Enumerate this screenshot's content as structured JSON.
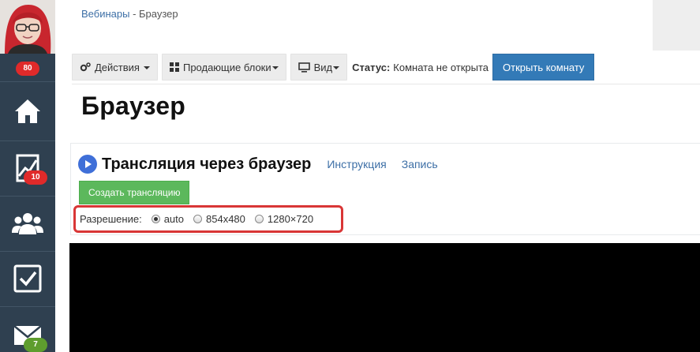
{
  "sidebar": {
    "avatar_badge": "80",
    "items": [
      {
        "icon": "home-icon"
      },
      {
        "icon": "chart-icon",
        "badge": "10"
      },
      {
        "icon": "users-icon"
      },
      {
        "icon": "checkbox-icon"
      },
      {
        "icon": "mail-icon",
        "badge": "7"
      }
    ]
  },
  "breadcrumb": {
    "parent": "Вебинары",
    "separator": " - ",
    "current": "Браузер"
  },
  "toolbar": {
    "actions_label": "Действия",
    "blocks_label": "Продающие блоки",
    "view_label": "Вид",
    "status_label": "Статус:",
    "status_value": "Комната не открыта",
    "open_room_label": "Открыть комнату"
  },
  "page": {
    "title": "Браузер"
  },
  "panel": {
    "title": "Трансляция через браузер",
    "link_instruction": "Инструкция",
    "link_record": "Запись",
    "create_button": "Создать трансляцию",
    "resolution_label": "Разрешение:",
    "resolutions": [
      {
        "label": "auto",
        "checked": true
      },
      {
        "label": "854x480",
        "checked": false
      },
      {
        "label": "1280×720",
        "checked": false
      }
    ]
  },
  "colors": {
    "sidebar_bg": "#2f4050",
    "primary": "#337ab7",
    "success": "#5cb85c",
    "badge_red": "#e02a2a",
    "badge_green": "#5e9d2e",
    "highlight_border": "#d93636"
  }
}
